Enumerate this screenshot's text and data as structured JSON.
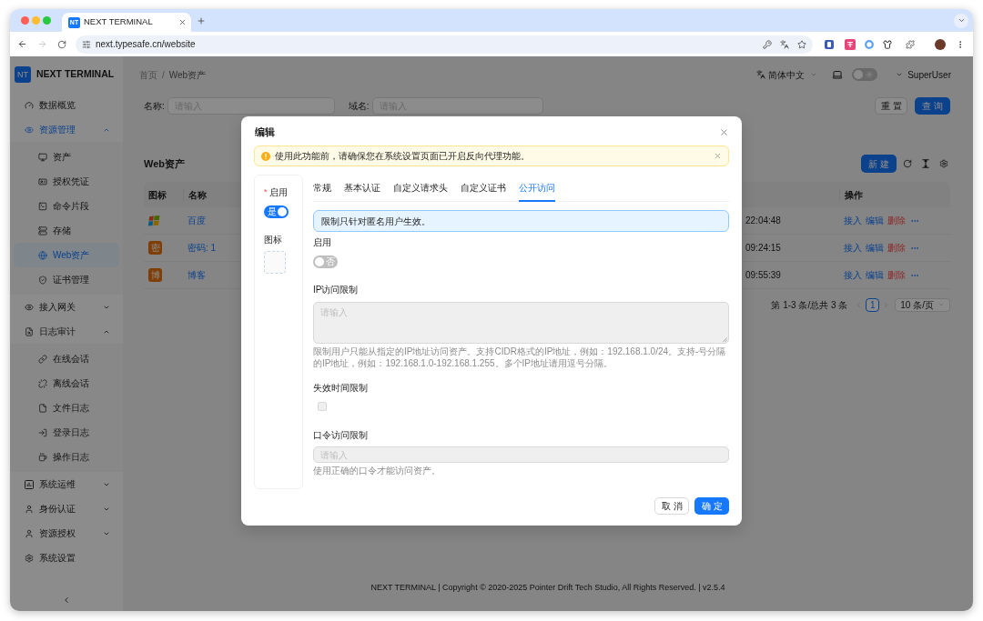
{
  "browser": {
    "tab": {
      "favicon_text": "NT",
      "title": "NEXT TERMINAL",
      "selected": true
    },
    "nav": {
      "back_disabled": false,
      "forward_disabled": true
    },
    "address": "next.typesafe.cn/website"
  },
  "sidebar": {
    "logo_text": "NT",
    "brand": "NEXT TERMINAL",
    "items": [
      {
        "label": "数据概览",
        "kind": "link",
        "selected": false
      },
      {
        "label": "资源管理",
        "kind": "group",
        "expanded": true,
        "selected": true,
        "children": [
          {
            "label": "资产",
            "selected": false
          },
          {
            "label": "授权凭证",
            "selected": false
          },
          {
            "label": "命令片段",
            "selected": false
          },
          {
            "label": "存储",
            "selected": false
          },
          {
            "label": "Web资产",
            "selected": true
          },
          {
            "label": "证书管理",
            "selected": false
          }
        ]
      },
      {
        "label": "接入网关",
        "kind": "group",
        "expanded": false,
        "selected": false
      },
      {
        "label": "日志审计",
        "kind": "group",
        "expanded": true,
        "selected": false,
        "children": [
          {
            "label": "在线会话",
            "selected": false
          },
          {
            "label": "离线会话",
            "selected": false
          },
          {
            "label": "文件日志",
            "selected": false
          },
          {
            "label": "登录日志",
            "selected": false
          },
          {
            "label": "操作日志",
            "selected": false
          }
        ]
      },
      {
        "label": "系统运维",
        "kind": "group",
        "expanded": false,
        "selected": false
      },
      {
        "label": "身份认证",
        "kind": "group",
        "expanded": false,
        "selected": false
      },
      {
        "label": "资源授权",
        "kind": "group",
        "expanded": false,
        "selected": false
      },
      {
        "label": "系统设置",
        "kind": "link",
        "selected": false
      }
    ]
  },
  "header": {
    "breadcrumb": [
      "首页",
      "Web资产"
    ],
    "breadcrumb_separator": "/",
    "language": "简体中文",
    "theme_switch": {
      "on": false
    },
    "user": "SuperUser"
  },
  "filters": {
    "fields": [
      {
        "label": "名称:",
        "placeholder": "请输入"
      },
      {
        "label": "域名:",
        "placeholder": "请输入"
      }
    ],
    "buttons": [
      {
        "label": "重置",
        "kind": "default"
      },
      {
        "label": "查询",
        "kind": "primary"
      }
    ]
  },
  "table": {
    "title": "Web资产",
    "new_button": "新建",
    "columns": [
      "图标",
      "名称",
      "操作"
    ],
    "rows": [
      {
        "icon": {
          "kind": "image"
        },
        "name": "百度",
        "time": "22:04:48",
        "actions": [
          {
            "label": "接入",
            "kind": "link"
          },
          {
            "label": "编辑",
            "kind": "link"
          },
          {
            "label": "删除",
            "kind": "danger"
          }
        ]
      },
      {
        "icon": {
          "kind": "letter",
          "text": "密"
        },
        "name": "密码: 1",
        "time": "09:24:15",
        "actions": [
          {
            "label": "接入",
            "kind": "link"
          },
          {
            "label": "编辑",
            "kind": "link"
          },
          {
            "label": "删除",
            "kind": "danger"
          }
        ]
      },
      {
        "icon": {
          "kind": "letter",
          "text": "博"
        },
        "name": "博客",
        "time": "09:55:39",
        "actions": [
          {
            "label": "接入",
            "kind": "link"
          },
          {
            "label": "编辑",
            "kind": "link"
          },
          {
            "label": "删除",
            "kind": "danger"
          }
        ]
      }
    ]
  },
  "pagination": {
    "summary": "第 1-3 条/总共 3 条",
    "pages": [
      {
        "label": "1",
        "selected": true
      }
    ],
    "page_size": "10 条/页"
  },
  "footer": "NEXT TERMINAL | Copyright © 2020-2025 Pointer Drift Tech Studio, All Rights Reserved. | v2.5.4",
  "modal": {
    "title": "编辑",
    "alert": {
      "kind": "warning",
      "text": "使用此功能前，请确保您在系统设置页面已开启反向代理功能。"
    },
    "side": {
      "enable": {
        "label": "启用",
        "required_mark": "*",
        "on": true,
        "switch_text": "是"
      },
      "icon_label": "图标"
    },
    "tabs": [
      {
        "label": "常规",
        "selected": false
      },
      {
        "label": "基本认证",
        "selected": false
      },
      {
        "label": "自定义请求头",
        "selected": false
      },
      {
        "label": "自定义证书",
        "selected": false
      },
      {
        "label": "公开访问",
        "selected": true
      }
    ],
    "notice": {
      "kind": "info",
      "text": "限制只针对匿名用户生效。"
    },
    "fields": [
      {
        "kind": "switch",
        "label": "启用",
        "on": false,
        "switch_text": "否"
      },
      {
        "kind": "textarea",
        "label": "IP访问限制",
        "placeholder": "请输入",
        "disabled": true,
        "help": "限制用户只能从指定的IP地址访问资产。支持CIDR格式的IP地址，例如：192.168.1.0/24。支持-号分隔的IP地址，例如：192.168.1.0-192.168.1.255。多个IP地址请用逗号分隔。"
      },
      {
        "kind": "checkbox",
        "label": "失效时间限制",
        "checked": false,
        "disabled": true
      },
      {
        "kind": "input",
        "label": "口令访问限制",
        "placeholder": "请输入",
        "disabled": true,
        "help": "使用正确的口令才能访问资产。"
      }
    ],
    "buttons": [
      {
        "label": "取消",
        "kind": "default"
      },
      {
        "label": "确定",
        "kind": "primary"
      }
    ]
  }
}
